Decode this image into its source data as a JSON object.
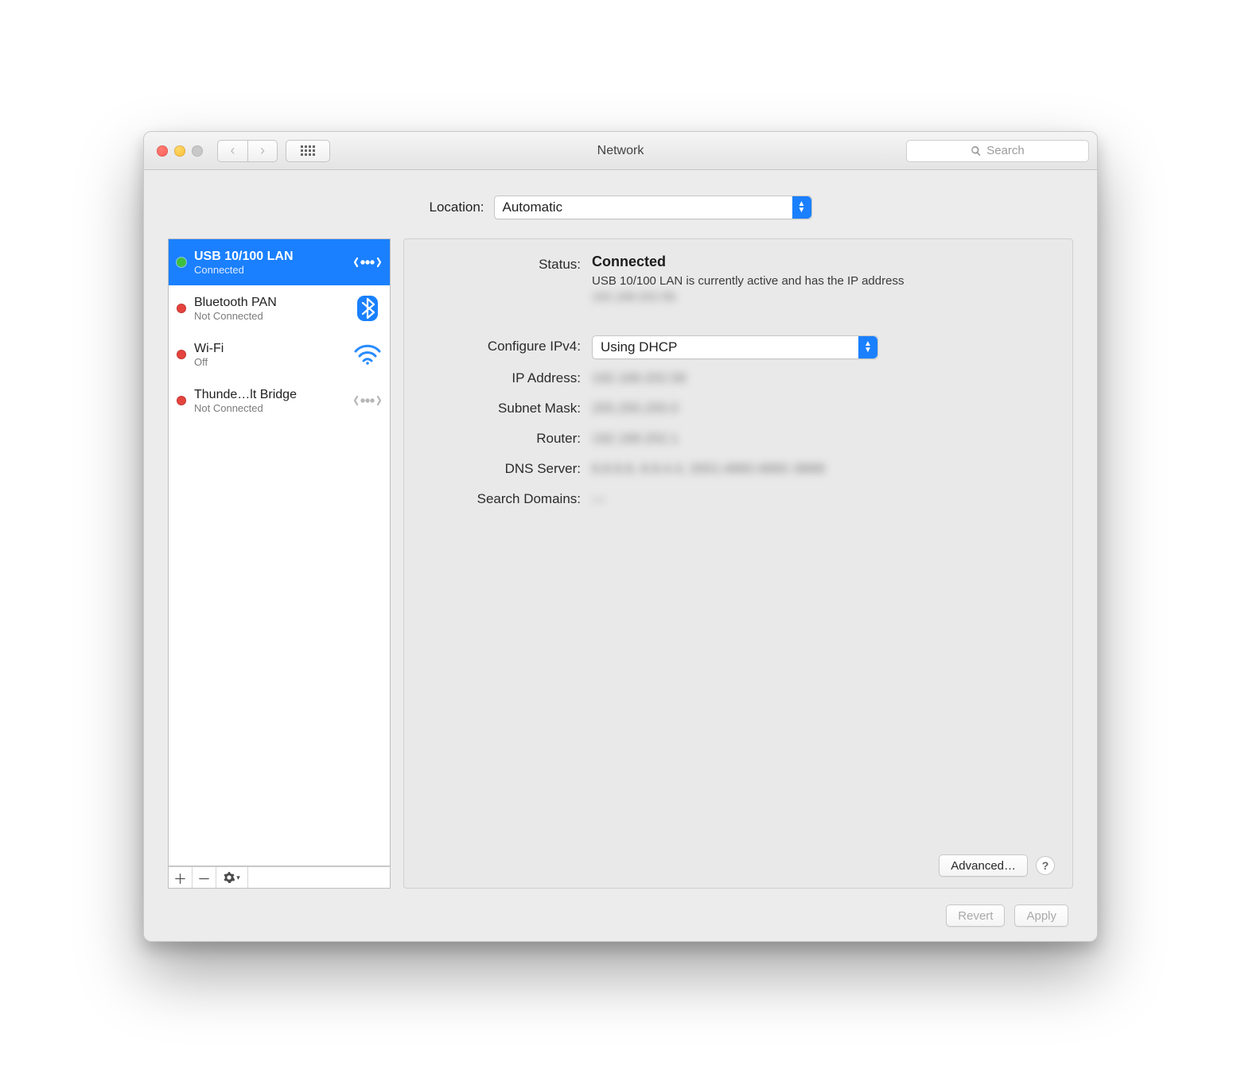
{
  "window": {
    "title": "Network"
  },
  "toolbar": {
    "search_placeholder": "Search"
  },
  "location": {
    "label": "Location:",
    "value": "Automatic"
  },
  "sidebar": {
    "items": [
      {
        "name": "USB 10/100 LAN",
        "status": "Connected",
        "state": "green",
        "selected": true,
        "icon": "ethernet"
      },
      {
        "name": "Bluetooth PAN",
        "status": "Not Connected",
        "state": "red",
        "selected": false,
        "icon": "bluetooth"
      },
      {
        "name": "Wi-Fi",
        "status": "Off",
        "state": "red",
        "selected": false,
        "icon": "wifi"
      },
      {
        "name": "Thunde…lt Bridge",
        "status": "Not Connected",
        "state": "red",
        "selected": false,
        "icon": "ethernet-gray"
      }
    ]
  },
  "detail": {
    "status_label": "Status:",
    "status_value": "Connected",
    "status_desc_prefix": "USB 10/100 LAN is currently active and has the IP address ",
    "status_desc_ip": "192.168.202.58.",
    "configure_label": "Configure IPv4:",
    "configure_value": "Using DHCP",
    "ip_label": "IP Address:",
    "ip_value": "192.168.202.58",
    "subnet_label": "Subnet Mask:",
    "subnet_value": "255.255.255.0",
    "router_label": "Router:",
    "router_value": "192.168.202.1",
    "dns_label": "DNS Server:",
    "dns_value": "8.8.8.8, 8.8.4.4, 2001:4860:4860::8888",
    "search_label": "Search Domains:",
    "search_value": "—",
    "advanced_label": "Advanced…"
  },
  "footer": {
    "revert": "Revert",
    "apply": "Apply"
  }
}
